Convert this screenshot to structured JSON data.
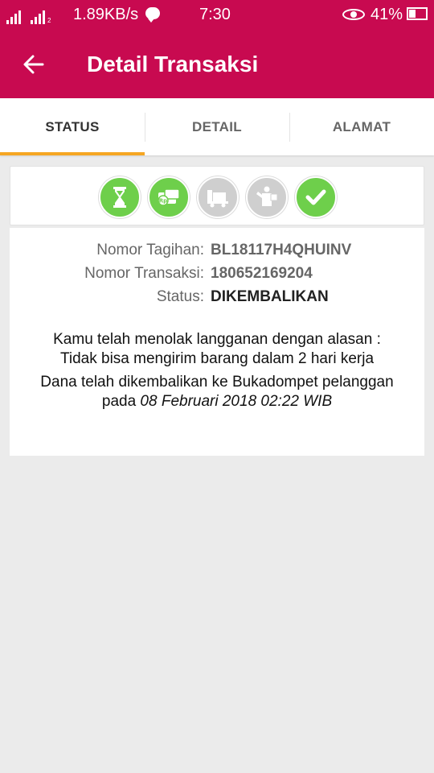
{
  "status_bar": {
    "speed": "1.89KB/s",
    "time": "7:30",
    "battery": "41%",
    "sim2_tag": "2",
    "icons": [
      "signal-icon",
      "hplus-signal-icon",
      "chat-icon",
      "eye-icon",
      "battery-icon"
    ]
  },
  "header": {
    "title": "Detail Transaksi",
    "back_icon": "arrow-left-icon",
    "background": "#c80a50"
  },
  "tabs": [
    {
      "label": "STATUS",
      "active": true
    },
    {
      "label": "DETAIL",
      "active": false
    },
    {
      "label": "ALAMAT",
      "active": false
    }
  ],
  "tab_indicator_color": "#f5a623",
  "progress_steps": [
    {
      "icon": "hourglass-icon",
      "state": "done"
    },
    {
      "icon": "rp-payment-icon",
      "state": "done"
    },
    {
      "icon": "delivery-truck-icon",
      "state": "pending"
    },
    {
      "icon": "courier-icon",
      "state": "pending"
    },
    {
      "icon": "checkmark-icon",
      "state": "done"
    }
  ],
  "step_colors": {
    "done": "#6ecf4b",
    "pending": "#cfcfcf"
  },
  "transaction": {
    "invoice_label": "Nomor Tagihan:",
    "invoice_value": "BL18117H4QHUINV",
    "transaction_label": "Nomor Transaksi:",
    "transaction_value": "180652169204",
    "status_label": "Status:",
    "status_value": "DIKEMBALIKAN"
  },
  "message": {
    "line1": "Kamu telah menolak langganan dengan alasan :",
    "line2": "Tidak bisa mengirim barang dalam 2 hari kerja",
    "line3": "Dana telah dikembalikan ke Bukadompet pelanggan",
    "line4_prefix": "pada ",
    "line4_date": "08 Februari 2018 02:22 WIB"
  }
}
